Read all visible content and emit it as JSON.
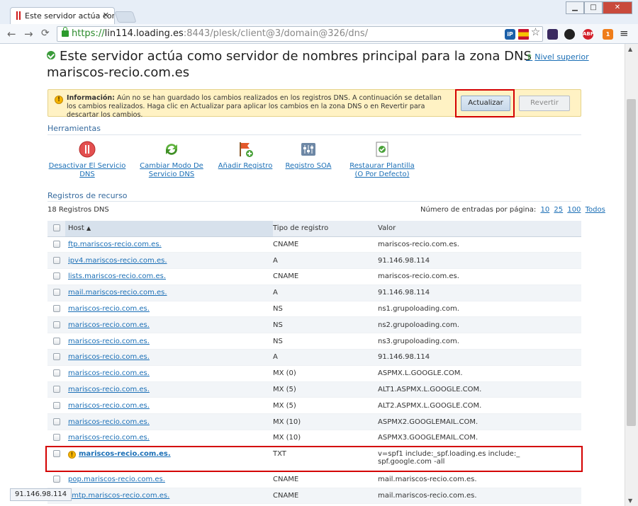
{
  "browser": {
    "tab_title": "Este servidor actúa como",
    "url_proto": "https://",
    "url_host": "lin114.loading.es",
    "url_path": ":8443/plesk/client@3/domain@326/dns/",
    "status_text": "91.146.98.114"
  },
  "page": {
    "title_line1": "Este servidor actúa como servidor de nombres principal para la zona DNS",
    "title_line2": "mariscos-recio.com.es",
    "up_link": "Nivel superior"
  },
  "info": {
    "label": "Información:",
    "message": "Aún no se han guardado los cambios realizados en los registros DNS. A continuación se detallan los cambios realizados. Haga clic en Actualizar para aplicar los cambios en la zona DNS o en Revertir para descartar los cambios.",
    "update_button": "Actualizar",
    "revert_button": "Revertir"
  },
  "tools": {
    "heading": "Herramientas",
    "items": [
      {
        "label": "Desactivar El Servicio DNS"
      },
      {
        "label": "Cambiar Modo De Servicio DNS"
      },
      {
        "label": "Añadir Registro"
      },
      {
        "label": "Registro SOA"
      },
      {
        "label": "Restaurar Plantilla (O Por Defecto)"
      }
    ]
  },
  "records": {
    "heading": "Registros de recurso",
    "count_label": "18 Registros DNS",
    "per_page_label": "Número de entradas por página:",
    "per_page_options": [
      "10",
      "25",
      "100",
      "Todos"
    ],
    "columns": {
      "host": "Host",
      "type": "Tipo de registro",
      "value": "Valor"
    },
    "rows": [
      {
        "host": "ftp.mariscos-recio.com.es.",
        "type": "CNAME",
        "value": "mariscos-recio.com.es."
      },
      {
        "host": "ipv4.mariscos-recio.com.es.",
        "type": "A",
        "value": "91.146.98.114"
      },
      {
        "host": "lists.mariscos-recio.com.es.",
        "type": "CNAME",
        "value": "mariscos-recio.com.es."
      },
      {
        "host": "mail.mariscos-recio.com.es.",
        "type": "A",
        "value": "91.146.98.114"
      },
      {
        "host": "mariscos-recio.com.es.",
        "type": "NS",
        "value": "ns1.grupoloading.com."
      },
      {
        "host": "mariscos-recio.com.es.",
        "type": "NS",
        "value": "ns2.grupoloading.com."
      },
      {
        "host": "mariscos-recio.com.es.",
        "type": "NS",
        "value": "ns3.grupoloading.com."
      },
      {
        "host": "mariscos-recio.com.es.",
        "type": "A",
        "value": "91.146.98.114"
      },
      {
        "host": "mariscos-recio.com.es.",
        "type": "MX (0)",
        "value": "ASPMX.L.GOOGLE.COM."
      },
      {
        "host": "mariscos-recio.com.es.",
        "type": "MX (5)",
        "value": "ALT1.ASPMX.L.GOOGLE.COM."
      },
      {
        "host": "mariscos-recio.com.es.",
        "type": "MX (5)",
        "value": "ALT2.ASPMX.L.GOOGLE.COM."
      },
      {
        "host": "mariscos-recio.com.es.",
        "type": "MX (10)",
        "value": "ASPMX2.GOOGLEMAIL.COM."
      },
      {
        "host": "mariscos-recio.com.es.",
        "type": "MX (10)",
        "value": "ASPMX3.GOOGLEMAIL.COM."
      }
    ],
    "txt_row": {
      "host": "mariscos-recio.com.es.",
      "type": "TXT",
      "value_line1": "v=spf1 include:_spf.loading.es include:_",
      "value_line2": "spf.google.com -all"
    },
    "rows_after": [
      {
        "host": "pop.mariscos-recio.com.es.",
        "type": "CNAME",
        "value": "mail.mariscos-recio.com.es."
      },
      {
        "host": "smtp.mariscos-recio.com.es.",
        "type": "CNAME",
        "value": "mail.mariscos-recio.com.es."
      }
    ]
  }
}
